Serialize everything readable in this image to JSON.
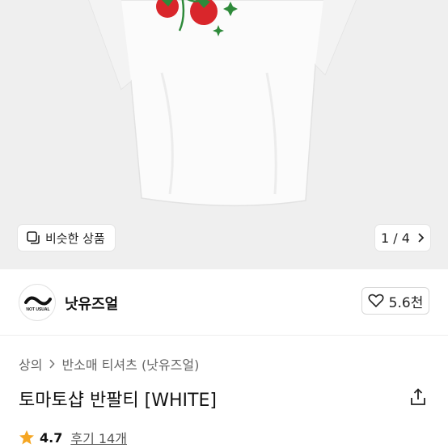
{
  "gallery": {
    "similar_label": "비슷한 상품",
    "pager": {
      "current": "1",
      "separator": "/",
      "total": "4"
    }
  },
  "brand": {
    "logo_text": "NOT USUAL",
    "name": "낫유즈얼",
    "like_count": "5.6천"
  },
  "breadcrumb": {
    "items": [
      "상의",
      "반소매 티셔츠 (낫유즈얼)"
    ]
  },
  "product": {
    "title": "토마토샵 반팔티 [WHITE]"
  },
  "rating": {
    "score": "4.7",
    "reviews_label": "후기 14개"
  },
  "colors": {
    "gallery_bg": "#efefef",
    "star": "#f5a623",
    "tomato": "#d9262b",
    "leaf": "#2e8a3a"
  }
}
